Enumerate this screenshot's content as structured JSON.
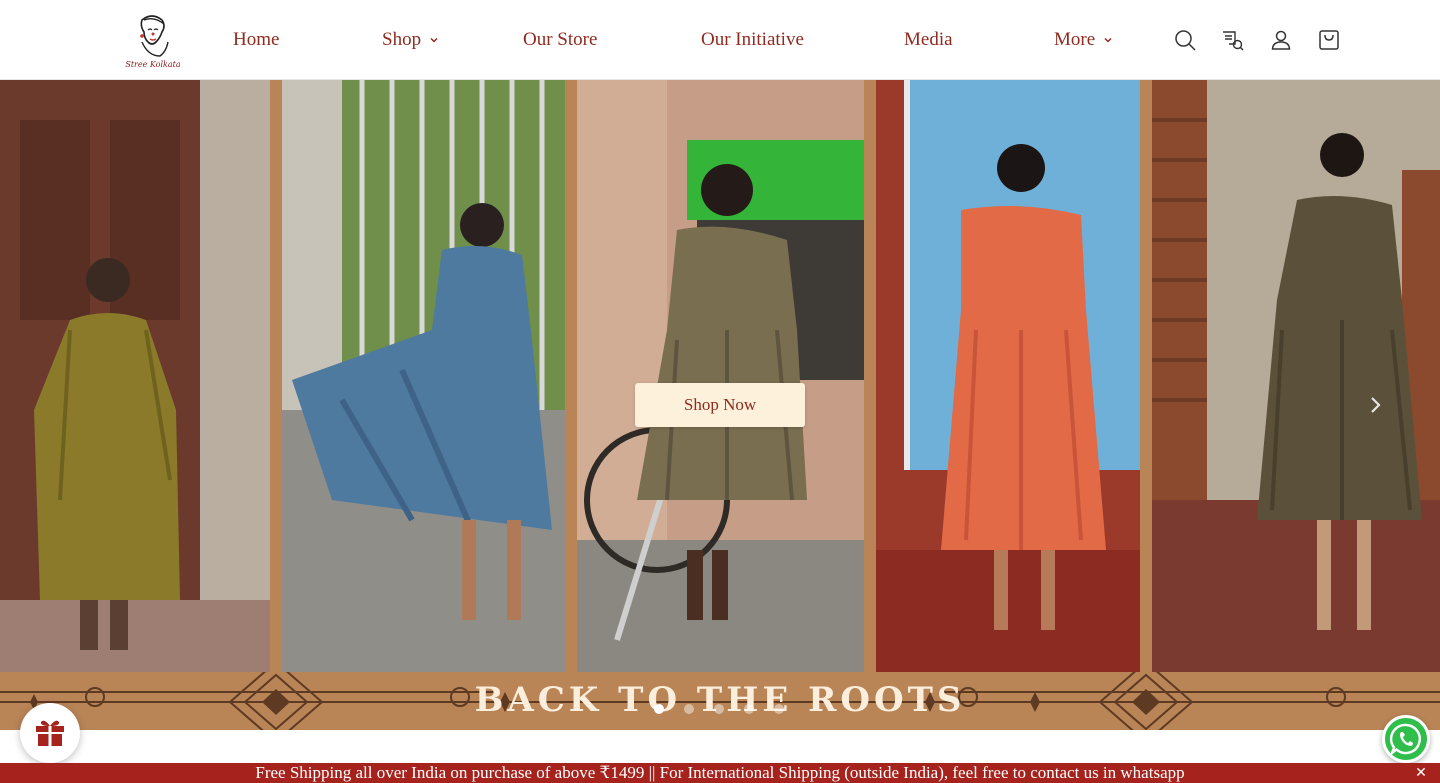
{
  "brand": {
    "logo_text": "Stree Kolkata",
    "color": "#8f2b1f"
  },
  "nav": {
    "items": [
      {
        "label": "Home"
      },
      {
        "label": "Shop"
      },
      {
        "label": "Our Store"
      },
      {
        "label": "Our Initiative"
      },
      {
        "label": "Media"
      },
      {
        "label": "More"
      }
    ]
  },
  "header_icons": [
    "search-icon",
    "track-order-icon",
    "account-icon",
    "cart-icon"
  ],
  "hero": {
    "button_label": "Shop Now",
    "banner_title": "BACK TO THE ROOTS",
    "slides_count": 5,
    "active_slide": 1,
    "frame_color": "#b98557"
  },
  "announcement": {
    "text": "Free Shipping all over India on purchase of above ₹1499  ||  For International Shipping (outside India), feel free to contact us in whatsapp",
    "close_label": "✕",
    "color": "#a5221d"
  },
  "floating": {
    "gift": "gift-icon",
    "chat": "whatsapp-icon"
  }
}
